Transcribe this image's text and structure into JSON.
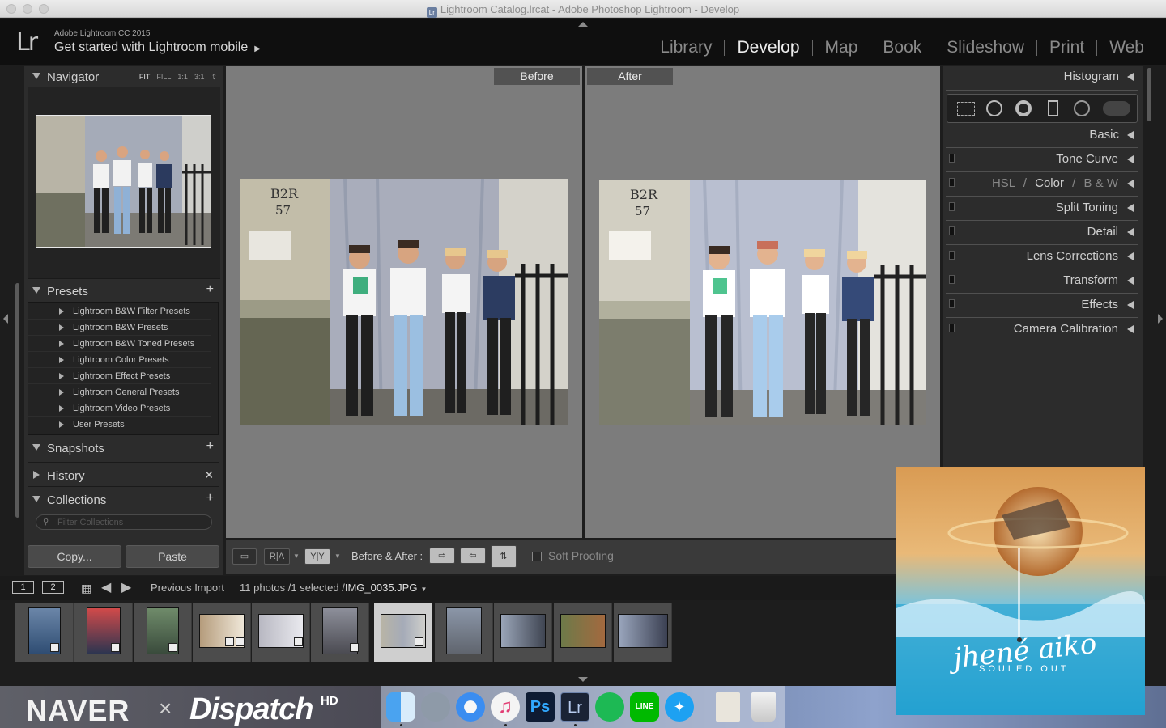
{
  "window": {
    "title": "Lightroom Catalog.lrcat - Adobe Photoshop Lightroom - Develop"
  },
  "header": {
    "logo": "Lr",
    "version": "Adobe Lightroom CC 2015",
    "mobile_prompt": "Get started with Lightroom mobile",
    "modules": [
      "Library",
      "Develop",
      "Map",
      "Book",
      "Slideshow",
      "Print",
      "Web"
    ],
    "active_module": "Develop"
  },
  "left_panel": {
    "navigator": {
      "title": "Navigator",
      "zoom_options": [
        "FIT",
        "FILL",
        "1:1",
        "3:1"
      ]
    },
    "presets": {
      "title": "Presets",
      "items": [
        "Lightroom B&W Filter Presets",
        "Lightroom B&W Presets",
        "Lightroom B&W Toned Presets",
        "Lightroom Color Presets",
        "Lightroom Effect Presets",
        "Lightroom General Presets",
        "Lightroom Video Presets",
        "User Presets"
      ]
    },
    "snapshots": {
      "title": "Snapshots"
    },
    "history": {
      "title": "History"
    },
    "collections": {
      "title": "Collections",
      "filter_placeholder": "Filter Collections"
    },
    "copy_label": "Copy...",
    "paste_label": "Paste"
  },
  "center": {
    "before_label": "Before",
    "after_label": "After"
  },
  "toolbar": {
    "ra_label": "R|A",
    "yy_label": "Y|Y",
    "before_after_label": "Before & After :",
    "soft_proofing_label": "Soft Proofing"
  },
  "right_panel": {
    "sections": [
      "Histogram",
      "Basic",
      "Tone Curve",
      "HSL / Color / B & W",
      "Split Toning",
      "Detail",
      "Lens Corrections",
      "Transform",
      "Effects",
      "Camera Calibration"
    ],
    "hsl_parts": [
      "HSL",
      "/",
      "Color",
      "/",
      "B & W"
    ]
  },
  "filmstrip": {
    "view1": "1",
    "view2": "2",
    "source": "Previous Import",
    "status_prefix": "11 photos /1 selected /",
    "filename": "IMG_0035.JPG",
    "selected_index": 6
  },
  "desktop": {
    "banner_left": "NAVER",
    "banner_x": "×",
    "banner_right": "Dispatch",
    "banner_hd": "HD"
  },
  "album": {
    "artist": "jhené aiko",
    "title": "SOULED OUT"
  }
}
